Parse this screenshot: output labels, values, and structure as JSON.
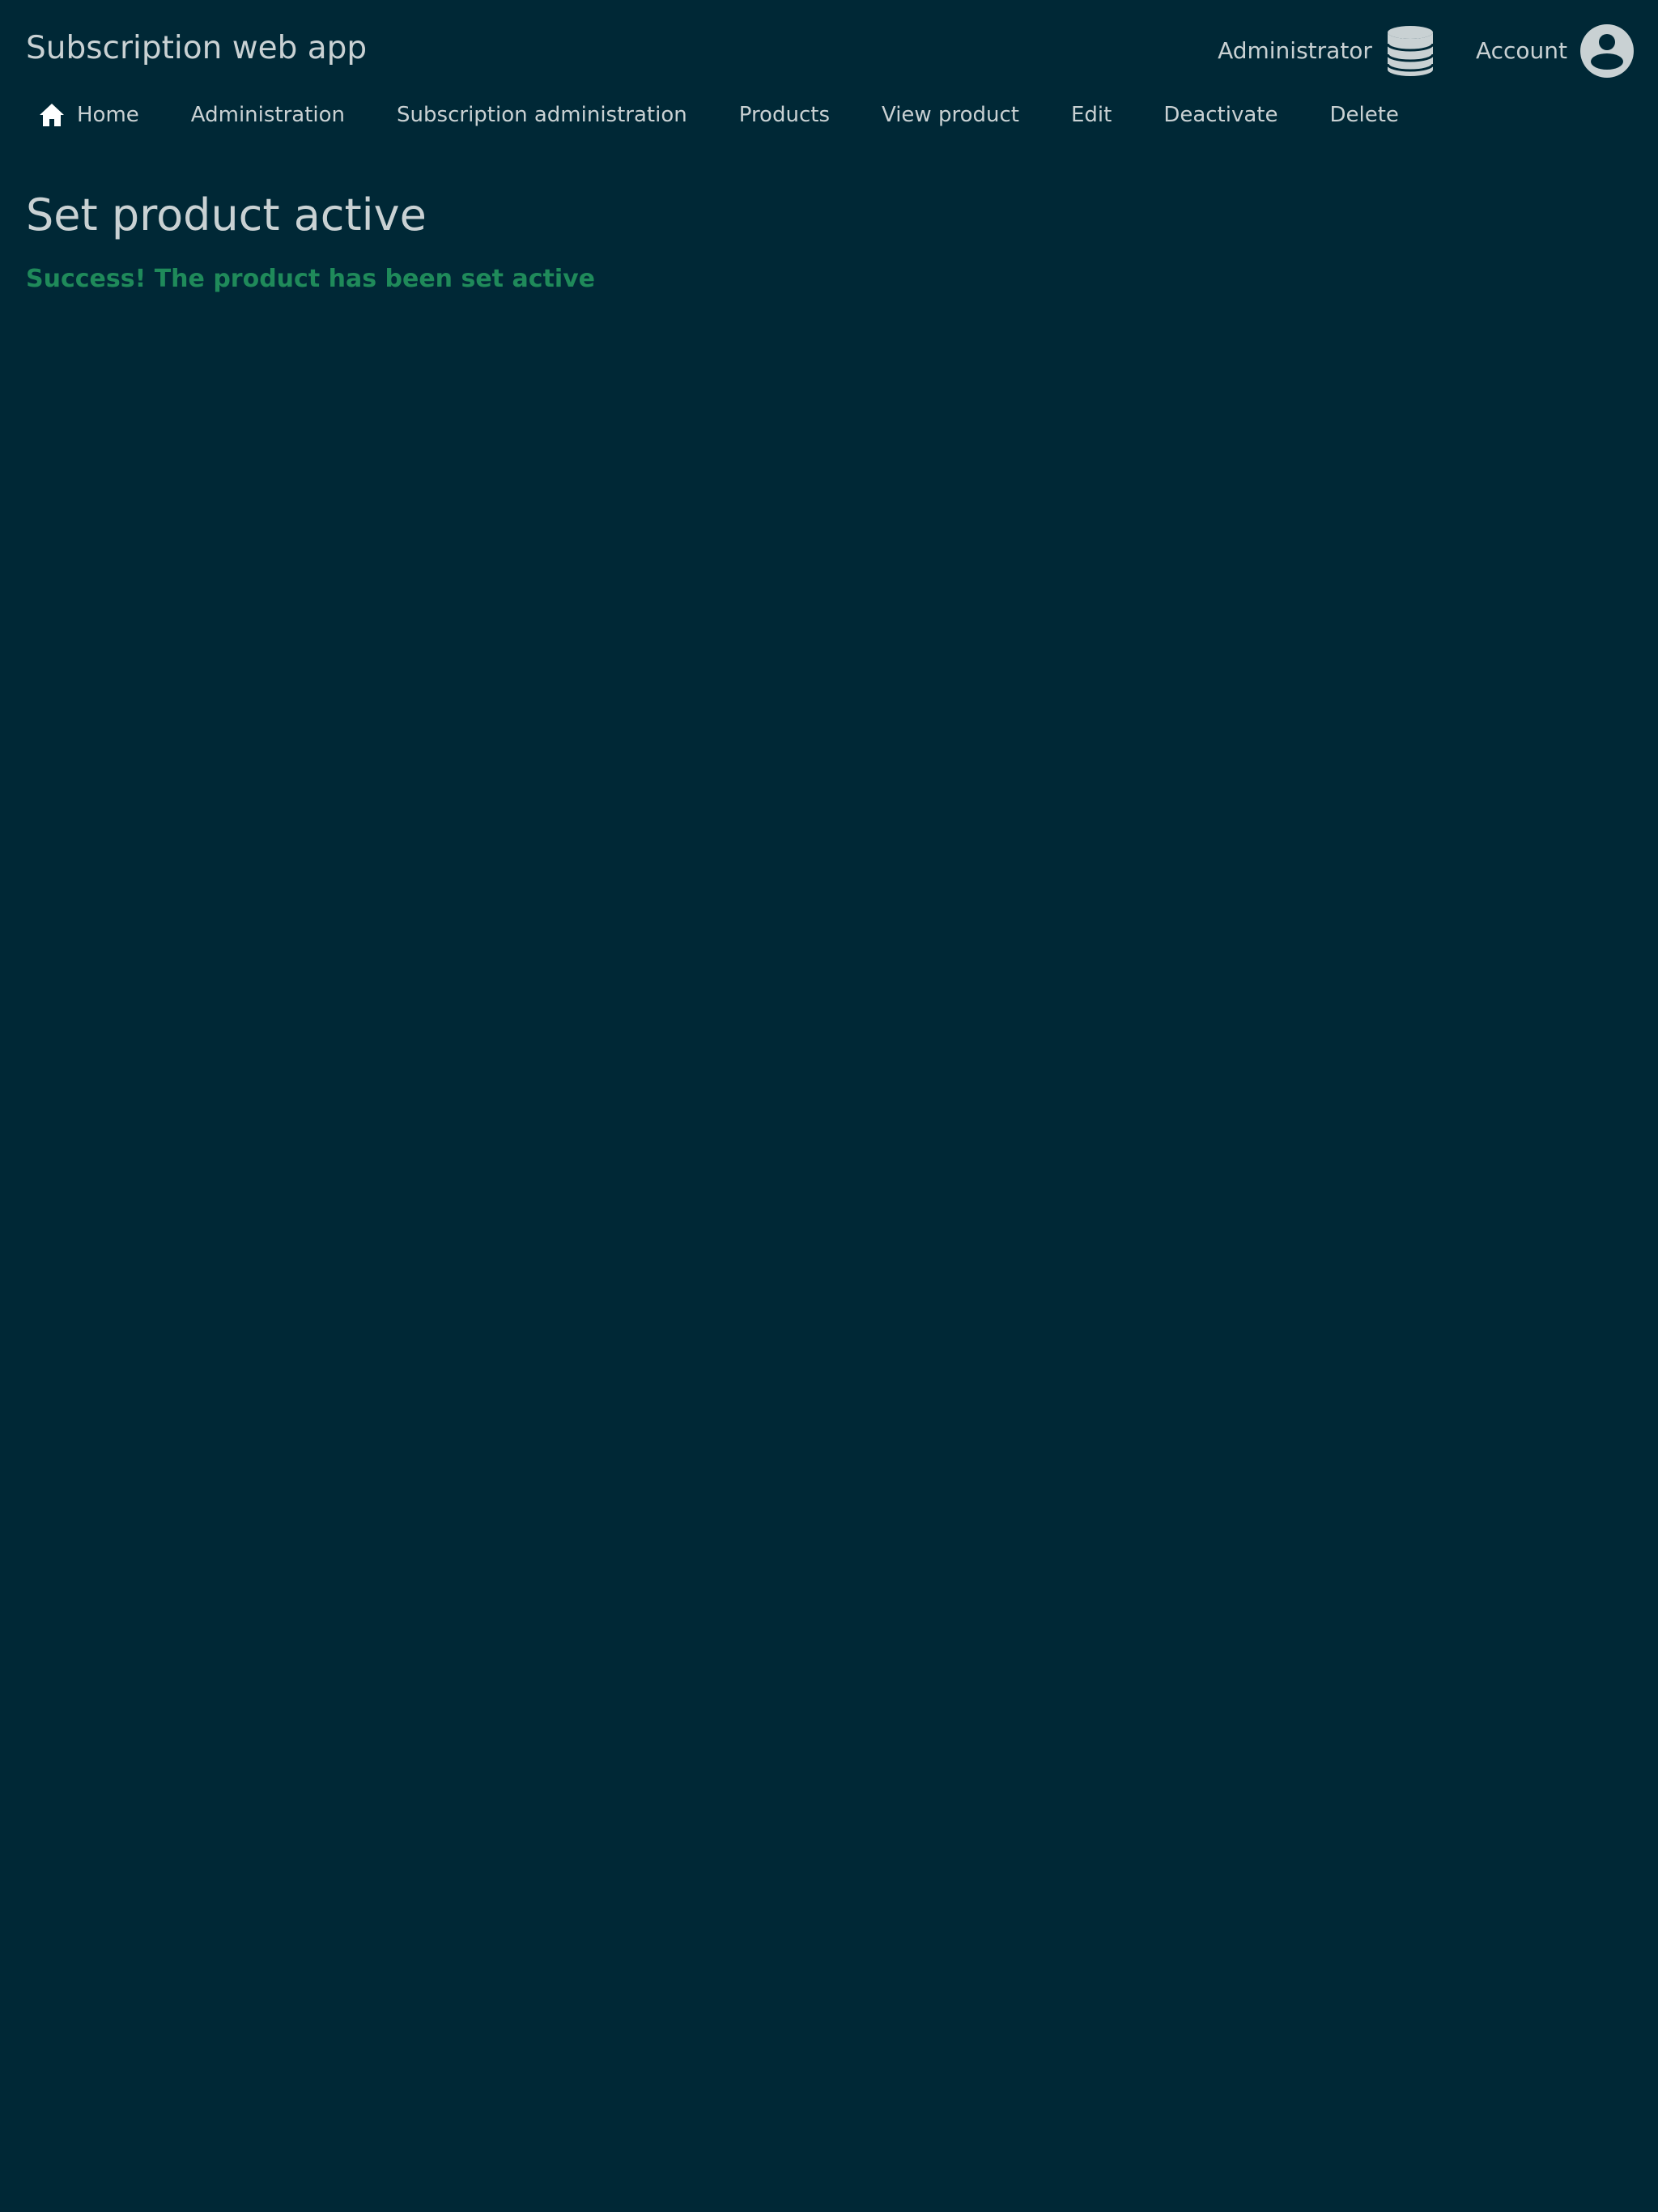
{
  "header": {
    "app_title": "Subscription web app",
    "admin_label": "Administrator",
    "account_label": "Account",
    "admin_icon": "database-icon",
    "account_icon": "user-circle-icon"
  },
  "nav": {
    "home_icon": "home-icon",
    "items": [
      "Home",
      "Administration",
      "Subscription administration",
      "Products",
      "View product",
      "Edit",
      "Deactivate",
      "Delete"
    ]
  },
  "main": {
    "title": "Set product active",
    "message": "Success! The product has been set active"
  },
  "colors": {
    "background": "#002836",
    "text": "#c9d1d3",
    "success": "#1f8a5a"
  }
}
